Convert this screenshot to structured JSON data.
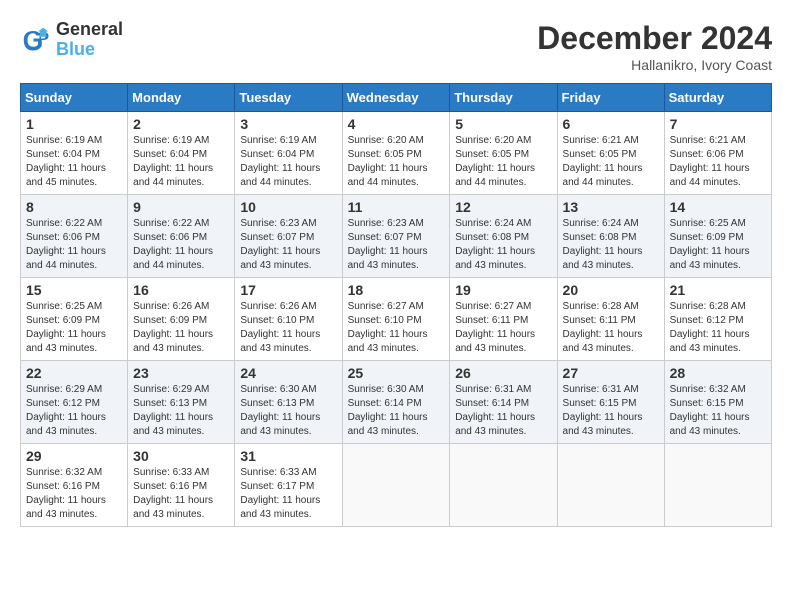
{
  "header": {
    "logo_line1": "General",
    "logo_line2": "Blue",
    "month_year": "December 2024",
    "location": "Hallanikro, Ivory Coast"
  },
  "days_of_week": [
    "Sunday",
    "Monday",
    "Tuesday",
    "Wednesday",
    "Thursday",
    "Friday",
    "Saturday"
  ],
  "weeks": [
    [
      {
        "day": 1,
        "info": "Sunrise: 6:19 AM\nSunset: 6:04 PM\nDaylight: 11 hours\nand 45 minutes."
      },
      {
        "day": 2,
        "info": "Sunrise: 6:19 AM\nSunset: 6:04 PM\nDaylight: 11 hours\nand 44 minutes."
      },
      {
        "day": 3,
        "info": "Sunrise: 6:19 AM\nSunset: 6:04 PM\nDaylight: 11 hours\nand 44 minutes."
      },
      {
        "day": 4,
        "info": "Sunrise: 6:20 AM\nSunset: 6:05 PM\nDaylight: 11 hours\nand 44 minutes."
      },
      {
        "day": 5,
        "info": "Sunrise: 6:20 AM\nSunset: 6:05 PM\nDaylight: 11 hours\nand 44 minutes."
      },
      {
        "day": 6,
        "info": "Sunrise: 6:21 AM\nSunset: 6:05 PM\nDaylight: 11 hours\nand 44 minutes."
      },
      {
        "day": 7,
        "info": "Sunrise: 6:21 AM\nSunset: 6:06 PM\nDaylight: 11 hours\nand 44 minutes."
      }
    ],
    [
      {
        "day": 8,
        "info": "Sunrise: 6:22 AM\nSunset: 6:06 PM\nDaylight: 11 hours\nand 44 minutes."
      },
      {
        "day": 9,
        "info": "Sunrise: 6:22 AM\nSunset: 6:06 PM\nDaylight: 11 hours\nand 44 minutes."
      },
      {
        "day": 10,
        "info": "Sunrise: 6:23 AM\nSunset: 6:07 PM\nDaylight: 11 hours\nand 43 minutes."
      },
      {
        "day": 11,
        "info": "Sunrise: 6:23 AM\nSunset: 6:07 PM\nDaylight: 11 hours\nand 43 minutes."
      },
      {
        "day": 12,
        "info": "Sunrise: 6:24 AM\nSunset: 6:08 PM\nDaylight: 11 hours\nand 43 minutes."
      },
      {
        "day": 13,
        "info": "Sunrise: 6:24 AM\nSunset: 6:08 PM\nDaylight: 11 hours\nand 43 minutes."
      },
      {
        "day": 14,
        "info": "Sunrise: 6:25 AM\nSunset: 6:09 PM\nDaylight: 11 hours\nand 43 minutes."
      }
    ],
    [
      {
        "day": 15,
        "info": "Sunrise: 6:25 AM\nSunset: 6:09 PM\nDaylight: 11 hours\nand 43 minutes."
      },
      {
        "day": 16,
        "info": "Sunrise: 6:26 AM\nSunset: 6:09 PM\nDaylight: 11 hours\nand 43 minutes."
      },
      {
        "day": 17,
        "info": "Sunrise: 6:26 AM\nSunset: 6:10 PM\nDaylight: 11 hours\nand 43 minutes."
      },
      {
        "day": 18,
        "info": "Sunrise: 6:27 AM\nSunset: 6:10 PM\nDaylight: 11 hours\nand 43 minutes."
      },
      {
        "day": 19,
        "info": "Sunrise: 6:27 AM\nSunset: 6:11 PM\nDaylight: 11 hours\nand 43 minutes."
      },
      {
        "day": 20,
        "info": "Sunrise: 6:28 AM\nSunset: 6:11 PM\nDaylight: 11 hours\nand 43 minutes."
      },
      {
        "day": 21,
        "info": "Sunrise: 6:28 AM\nSunset: 6:12 PM\nDaylight: 11 hours\nand 43 minutes."
      }
    ],
    [
      {
        "day": 22,
        "info": "Sunrise: 6:29 AM\nSunset: 6:12 PM\nDaylight: 11 hours\nand 43 minutes."
      },
      {
        "day": 23,
        "info": "Sunrise: 6:29 AM\nSunset: 6:13 PM\nDaylight: 11 hours\nand 43 minutes."
      },
      {
        "day": 24,
        "info": "Sunrise: 6:30 AM\nSunset: 6:13 PM\nDaylight: 11 hours\nand 43 minutes."
      },
      {
        "day": 25,
        "info": "Sunrise: 6:30 AM\nSunset: 6:14 PM\nDaylight: 11 hours\nand 43 minutes."
      },
      {
        "day": 26,
        "info": "Sunrise: 6:31 AM\nSunset: 6:14 PM\nDaylight: 11 hours\nand 43 minutes."
      },
      {
        "day": 27,
        "info": "Sunrise: 6:31 AM\nSunset: 6:15 PM\nDaylight: 11 hours\nand 43 minutes."
      },
      {
        "day": 28,
        "info": "Sunrise: 6:32 AM\nSunset: 6:15 PM\nDaylight: 11 hours\nand 43 minutes."
      }
    ],
    [
      {
        "day": 29,
        "info": "Sunrise: 6:32 AM\nSunset: 6:16 PM\nDaylight: 11 hours\nand 43 minutes."
      },
      {
        "day": 30,
        "info": "Sunrise: 6:33 AM\nSunset: 6:16 PM\nDaylight: 11 hours\nand 43 minutes."
      },
      {
        "day": 31,
        "info": "Sunrise: 6:33 AM\nSunset: 6:17 PM\nDaylight: 11 hours\nand 43 minutes."
      },
      null,
      null,
      null,
      null
    ]
  ]
}
